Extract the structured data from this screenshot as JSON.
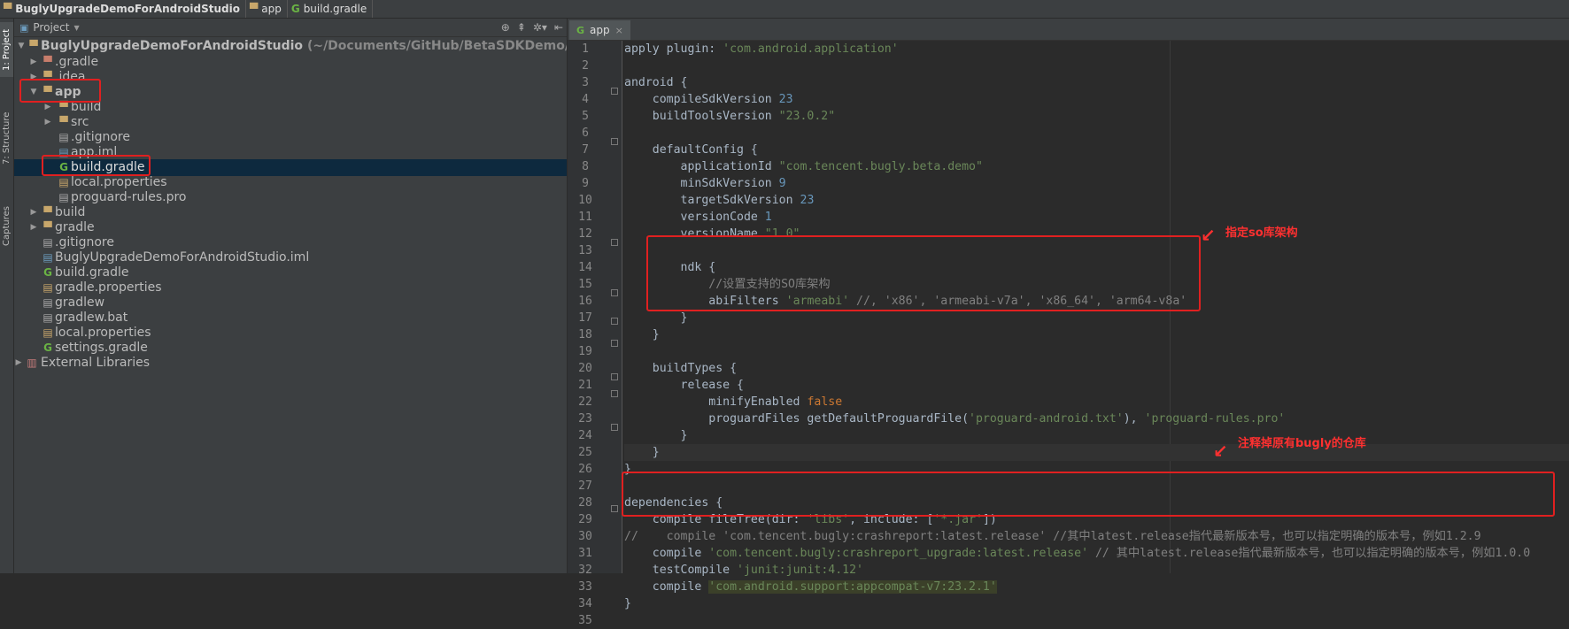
{
  "breadcrumb": [
    {
      "label": "BuglyUpgradeDemoForAndroidStudio",
      "icon": "folder-icon"
    },
    {
      "label": "app",
      "icon": "folder-icon"
    },
    {
      "label": "build.gradle",
      "icon": "gradle-icon"
    }
  ],
  "toolstrip": {
    "project_tab": "1: Project",
    "structure_tab": "7: Structure",
    "captures_tab": "Captures"
  },
  "project_panel": {
    "view_label": "Project",
    "tree": [
      {
        "label": "BuglyUpgradeDemoForAndroidStudio",
        "hint": "(~/Documents/GitHub/BetaSDKDemo/BuglyUpgradeDemoForAndroidStudio)",
        "icon": "folder-icon",
        "expanded": true,
        "bold": true
      },
      {
        "label": ".gradle",
        "icon": "folder-icon",
        "expanded": false
      },
      {
        "label": ".idea",
        "icon": "folder-icon",
        "expanded": false
      },
      {
        "label": "app",
        "icon": "folder-icon",
        "expanded": true,
        "bold": true
      },
      {
        "label": "build",
        "icon": "folder-icon",
        "expanded": false
      },
      {
        "label": "src",
        "icon": "folder-icon",
        "expanded": false
      },
      {
        "label": ".gitignore",
        "icon": "file-icon"
      },
      {
        "label": "app.iml",
        "icon": "iml-file-icon"
      },
      {
        "label": "build.gradle",
        "icon": "gradle-icon",
        "selected": true
      },
      {
        "label": "local.properties",
        "icon": "properties-file-icon"
      },
      {
        "label": "proguard-rules.pro",
        "icon": "file-icon"
      },
      {
        "label": "build",
        "icon": "folder-icon",
        "expanded": false
      },
      {
        "label": "gradle",
        "icon": "folder-icon",
        "expanded": false
      },
      {
        "label": ".gitignore",
        "icon": "file-icon"
      },
      {
        "label": "BuglyUpgradeDemoForAndroidStudio.iml",
        "icon": "iml-file-icon"
      },
      {
        "label": "build.gradle",
        "icon": "gradle-icon"
      },
      {
        "label": "gradle.properties",
        "icon": "properties-file-icon"
      },
      {
        "label": "gradlew",
        "icon": "file-icon"
      },
      {
        "label": "gradlew.bat",
        "icon": "file-icon"
      },
      {
        "label": "local.properties",
        "icon": "properties-file-icon"
      },
      {
        "label": "settings.gradle",
        "icon": "gradle-icon"
      },
      {
        "label": "External Libraries",
        "icon": "library-icon",
        "expanded": false
      }
    ]
  },
  "editor": {
    "tab_label": "app",
    "line_numbers": [
      "1",
      "2",
      "3",
      "4",
      "5",
      "6",
      "7",
      "8",
      "9",
      "10",
      "11",
      "12",
      "13",
      "14",
      "15",
      "16",
      "17",
      "18",
      "19",
      "20",
      "21",
      "22",
      "23",
      "24",
      "25",
      "26",
      "27",
      "28",
      "29",
      "30",
      "31",
      "32",
      "33",
      "34",
      "35"
    ],
    "code": {
      "l1a": "apply plugin: ",
      "l1b": "'com.android.application'",
      "l3": "android {",
      "l4a": "    compileSdkVersion ",
      "l4b": "23",
      "l5a": "    buildToolsVersion ",
      "l5b": "\"23.0.2\"",
      "l7": "    defaultConfig {",
      "l8a": "        applicationId ",
      "l8b": "\"com.tencent.bugly.beta.demo\"",
      "l9a": "        minSdkVersion ",
      "l9b": "9",
      "l10a": "        targetSdkVersion ",
      "l10b": "23",
      "l11a": "        versionCode ",
      "l11b": "1",
      "l12a": "        versionName ",
      "l12b": "\"1.0\"",
      "l14": "        ndk {",
      "l15": "            //设置支持的SO库架构",
      "l16a": "            abiFilters ",
      "l16b": "'armeabi'",
      "l16c": " //, 'x86', 'armeabi-v7a', 'x86_64', 'arm64-v8a'",
      "l17": "        }",
      "l18": "    }",
      "l20": "    buildTypes {",
      "l21": "        release {",
      "l22a": "            minifyEnabled ",
      "l22b": "false",
      "l23a": "            proguardFiles getDefaultProguardFile(",
      "l23b": "'proguard-android.txt'",
      "l23c": "), ",
      "l23d": "'proguard-rules.pro'",
      "l24": "        }",
      "l25": "    }",
      "l26": "}",
      "l28": "dependencies {",
      "l29a": "    compile fileTree(dir: ",
      "l29b": "'libs'",
      "l29c": ", include: [",
      "l29d": "'*.jar'",
      "l29e": "])",
      "l30": "//    compile 'com.tencent.bugly:crashreport:latest.release' //其中latest.release指代最新版本号，也可以指定明确的版本号，例如1.2.9",
      "l31a": "    compile ",
      "l31b": "'com.tencent.bugly:crashreport_upgrade:latest.release'",
      "l31c": " // 其中latest.release指代最新版本号，也可以指定明确的版本号，例如1.0.0",
      "l32a": "    testCompile ",
      "l32b": "'junit:junit:4.12'",
      "l33a": "    compile ",
      "l33b": "'com.android.support:appcompat-v7:23.2.1'",
      "l34": "}"
    }
  },
  "annotations": {
    "ndk_note": "指定so库架构",
    "deps_note": "注释掉原有bugly的仓库"
  },
  "colors": {
    "annotation": "#e02020",
    "keyword": "#cc7832",
    "string": "#6a8759",
    "number": "#6897bb",
    "comment": "#808080"
  }
}
